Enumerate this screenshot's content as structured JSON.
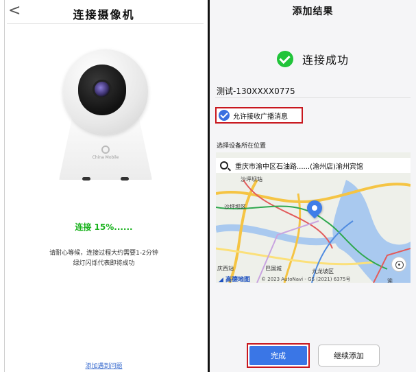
{
  "left": {
    "back_glyph": "<",
    "title": "连接摄像机",
    "camera_brand": "China Mobile",
    "progress_text": "连接 15%......",
    "progress_percent": 15,
    "hint_line1": "请耐心等候，连接过程大约需要1-2分钟",
    "hint_line2": "绿灯闪烁代表即将成功",
    "help_link": "添加遇到问题"
  },
  "right": {
    "title": "添加结果",
    "success_text": "连接成功",
    "device_name": "测试-130XXXX0775",
    "consent_label": "允许接收广播消息",
    "consent_checked": true,
    "location_label": "选择设备所在位置",
    "map": {
      "search_text": "重庆市渝中区石油路......(渝州店)渝州宾馆",
      "place_station": "沙坪坝站",
      "place_district": "沙坪坝区",
      "place_west": "庆西站",
      "place_bagu": "巴国城",
      "place_jiulong": "九龙坡区",
      "place_partial": "渝",
      "brand": "◢ 高德地图",
      "copyright": "© 2023 AutoNavi - GS (2021) 6375号"
    },
    "done_label": "完成",
    "continue_label": "继续添加"
  },
  "colors": {
    "success_green": "#21c43a",
    "progress_green": "#19b21d",
    "primary_blue": "#3a76e6",
    "highlight_red": "#c8171e"
  },
  "icons": [
    "back-chevron-icon",
    "success-check-icon",
    "checkbox-checked-icon",
    "search-icon",
    "map-pin-icon",
    "locate-icon"
  ]
}
